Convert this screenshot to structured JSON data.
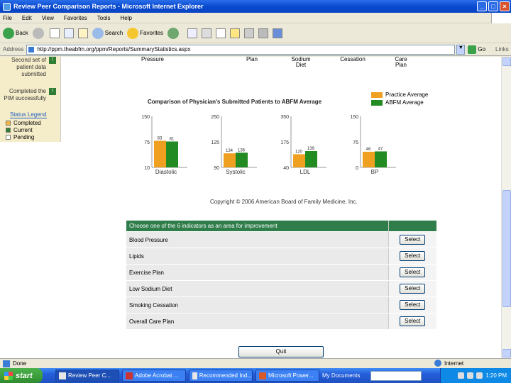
{
  "window": {
    "title": "Review Peer Comparison Reports - Microsoft Internet Explorer",
    "buttons": [
      "_",
      "□",
      "×"
    ]
  },
  "menu": [
    "File",
    "Edit",
    "View",
    "Favorites",
    "Tools",
    "Help"
  ],
  "toolbar": {
    "back": "Back",
    "search": "Search",
    "favorites": "Favorites"
  },
  "address": {
    "label": "Address",
    "url": "http://ppm.theabfm.org/ppm/Reports/SummaryStatistics.aspx",
    "go": "Go",
    "links": "Links"
  },
  "sidebar": {
    "items": [
      {
        "label": "Second set of patient data submitted",
        "check": "!"
      },
      {
        "label": "Completed the PIM successfully",
        "check": "!"
      }
    ],
    "legend_title": "Status Legend",
    "legend": [
      {
        "label": "Completed",
        "color": "#f5b942"
      },
      {
        "label": "Current",
        "color": "#2f7d32"
      },
      {
        "label": "Pending",
        "color": "#ffffff"
      }
    ]
  },
  "top_headers": [
    "Pressure",
    "Plan",
    "Sodium Diet",
    "Cessation",
    "Care Plan"
  ],
  "chart_title": "Comparison of Physician's Submitted Patients to ABFM Average",
  "chart_data": {
    "type": "bar",
    "series": [
      {
        "name": "Practice Average",
        "color": "#f0a020"
      },
      {
        "name": "ABFM Average",
        "color": "#228b22"
      }
    ],
    "charts": [
      {
        "category": "Diastolic",
        "yticks": [
          "150",
          "75",
          "10"
        ],
        "ylim": [
          10,
          150
        ],
        "values": [
          83,
          81
        ],
        "labels": [
          "83",
          "81"
        ]
      },
      {
        "category": "Systolic",
        "yticks": [
          "250",
          "125",
          "90"
        ],
        "ylim": [
          90,
          250
        ],
        "values": [
          134,
          136
        ],
        "labels": [
          "134",
          "136"
        ]
      },
      {
        "category": "LDL",
        "yticks": [
          "350",
          "175",
          "40"
        ],
        "ylim": [
          40,
          350
        ],
        "values": [
          120,
          139
        ],
        "labels": [
          "120",
          "139"
        ]
      },
      {
        "category": "BP",
        "yticks": [
          "150",
          "75",
          "0"
        ],
        "ylim": [
          0,
          150
        ],
        "values": [
          46,
          47
        ],
        "labels": [
          "46",
          "47"
        ]
      }
    ]
  },
  "copyright": "Copyright © 2006 American Board of Family Medicine, Inc.",
  "table": {
    "header": "Choose one of the 6 indicators as an area for improvement",
    "select_label": "Select",
    "rows": [
      "Blood Pressure",
      "Lipids",
      "Exercise Plan",
      "Low Sodium Diet",
      "Smoking Cessation",
      "Overall Care Plan"
    ]
  },
  "quit": "Quit",
  "status": {
    "left": "Done",
    "zone": "Internet"
  },
  "taskbar": {
    "start": "start",
    "tasks": [
      "Review Peer C...",
      "Adobe Acrobat ...",
      "Recommended Ind...",
      "Microsoft Power...",
      "My Documents"
    ],
    "clock": "1:20 PM"
  }
}
